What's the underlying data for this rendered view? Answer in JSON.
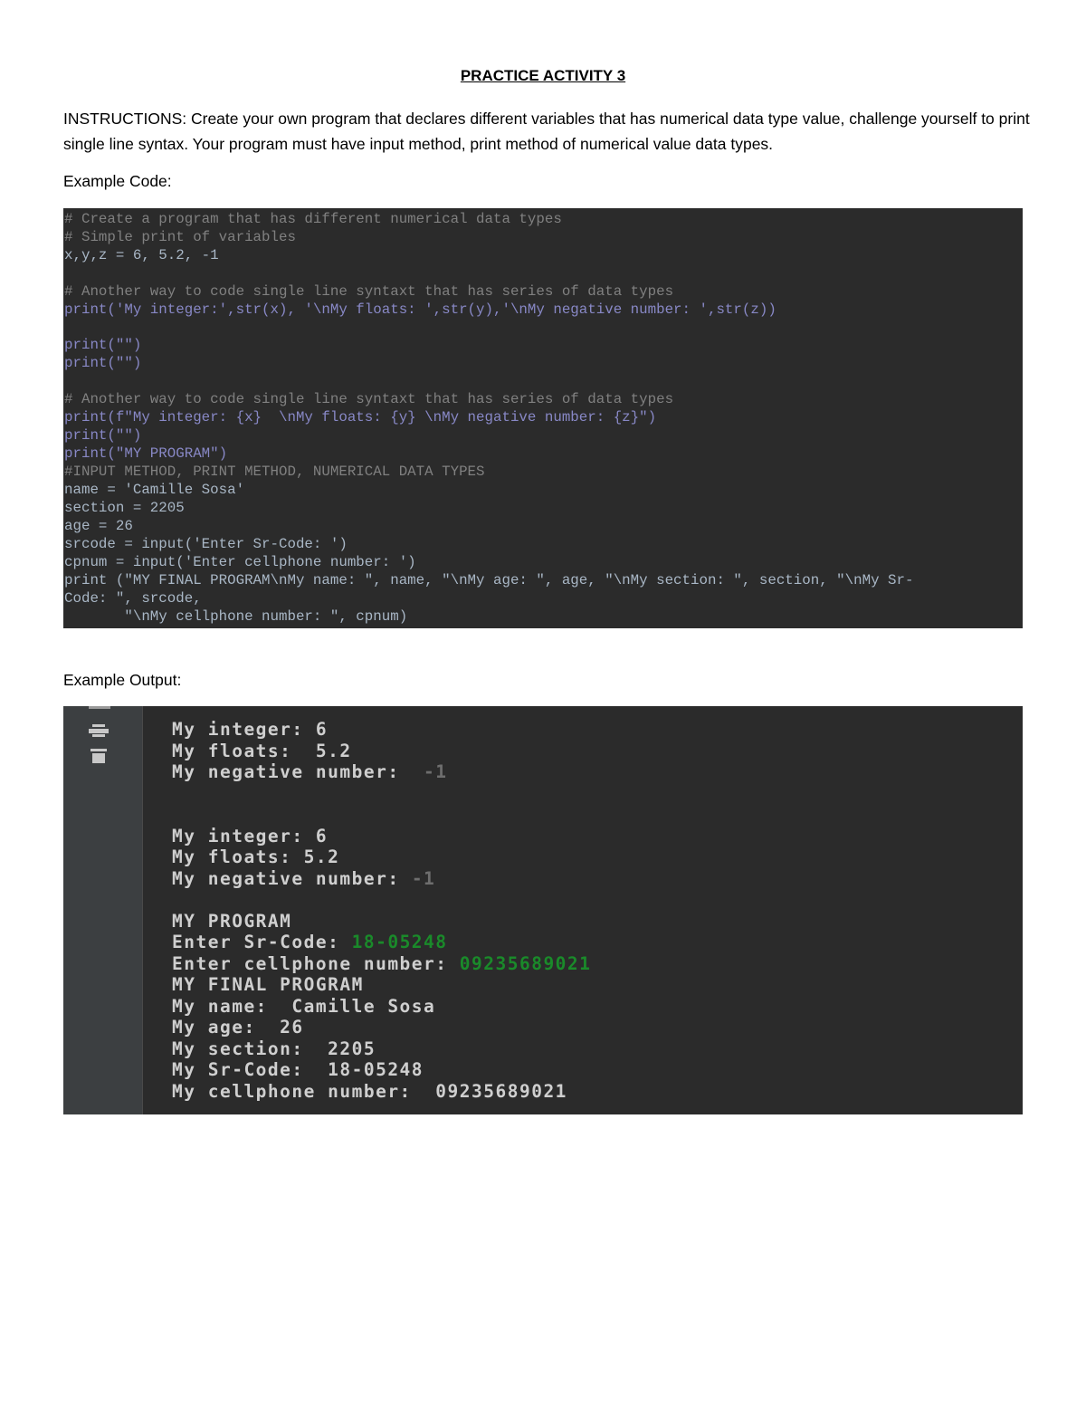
{
  "title": "PRACTICE ACTIVITY 3",
  "instructions": "INSTRUCTIONS: Create your own program that declares different variables that has numerical data type value, challenge yourself to print single line syntax. Your program must have input method, print method of numerical value data types.",
  "example_code_label": "Example Code:",
  "example_output_label": "Example Output:",
  "code": {
    "line1": "# Create a program that has different numerical data types",
    "line2": "# Simple print of variables",
    "line3": "x,y,z = 6, 5.2, -1",
    "line4": "# Another way to code single line syntaxt that has series of data types",
    "line5": "print('My integer:',str(x), '\\nMy floats: ',str(y),'\\nMy negative number: ',str(z))",
    "line6": "print(\"\")",
    "line7": "print(\"\")",
    "line8": "# Another way to code single line syntaxt that has series of data types",
    "line9": "print(f\"My integer: {x}  \\nMy floats: {y} \\nMy negative number: {z}\")",
    "line10": "print(\"\")",
    "line11": "print(\"MY PROGRAM\")",
    "line12": "#INPUT METHOD, PRINT METHOD, NUMERICAL DATA TYPES",
    "line13": "name = 'Camille Sosa'",
    "line14": "section = 2205",
    "line15": "age = 26",
    "line16": "srcode = input('Enter Sr-Code: ')",
    "line17": "cpnum = input('Enter cellphone number: ')",
    "line18": "print (\"MY FINAL PROGRAM\\nMy name: \", name, \"\\nMy age: \", age, \"\\nMy section: \", section, \"\\nMy Sr-",
    "line19": "Code: \", srcode,",
    "line20": "       \"\\nMy cellphone number: \", cpnum)"
  },
  "output": {
    "l1": "My integer: 6",
    "l2": "My floats:  5.2",
    "l3a": "My negative number: ",
    "l3b": " -1",
    "l4": "My integer: 6",
    "l5": "My floats: 5.2",
    "l6a": "My negative number: ",
    "l6b": "-1",
    "l7": "MY PROGRAM",
    "l8a": "Enter Sr-Code: ",
    "l8b": "18-05248",
    "l9a": "Enter cellphone number: ",
    "l9b": "09235689021",
    "l10": "MY FINAL PROGRAM",
    "l11": "My name:  Camille Sosa",
    "l12": "My age:  26",
    "l13": "My section:  2205",
    "l14": "My Sr-Code:  18-05248",
    "l15": "My cellphone number:  09235689021"
  }
}
